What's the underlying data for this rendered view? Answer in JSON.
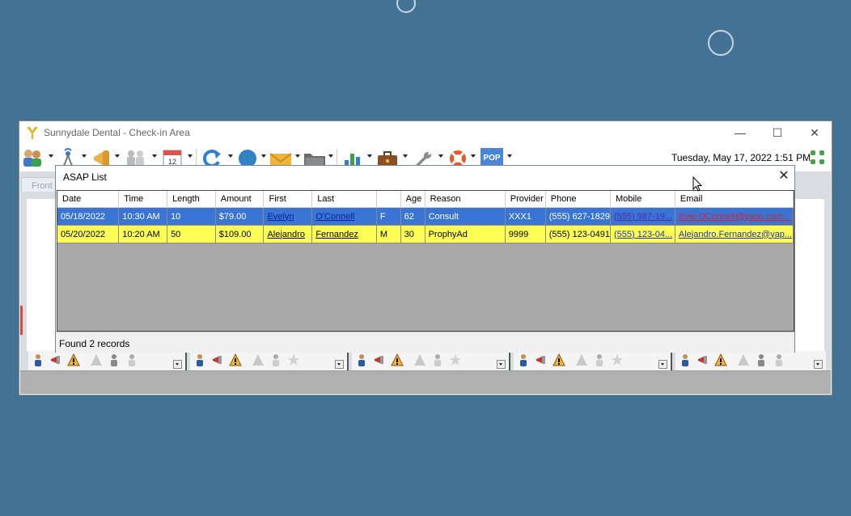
{
  "window": {
    "title": "Sunnydale Dental - Check-in Area",
    "clock": "Tuesday, May 17, 2022 1:51 PM",
    "tab_front": "Front",
    "controls": {
      "minimize": "—",
      "maximize": "☐",
      "close": "✕"
    }
  },
  "toolbar": {
    "items": [
      "patients-icon",
      "radio-icon",
      "megaphone-icon",
      "people-icon",
      "calendar-icon",
      "refresh-icon",
      "globe-icon",
      "envelope-icon",
      "folder-icon",
      "bar-chart-icon",
      "briefcase-icon",
      "wrench-icon",
      "lifebuoy-icon",
      "pop-icon"
    ],
    "calendar_day": "12",
    "pop_label": "POP"
  },
  "asap_dialog": {
    "title": "ASAP List",
    "close_label": "✕",
    "columns": [
      "Date",
      "Time",
      "Length",
      "Amount",
      "First",
      "Last",
      "",
      "Age",
      "Reason",
      "Provider",
      "Phone",
      "Mobile",
      "Email"
    ],
    "rows": [
      [
        "05/18/2022",
        "10:30 AM",
        "10",
        "$79.00",
        "Evelyn",
        "O'Connell",
        "F",
        "62",
        "Consult",
        "XXX1",
        "(555) 627-1829",
        "(555) 987-19...",
        "Evie.OConnell@yaoo.com..."
      ],
      [
        "05/20/2022",
        "10:20 AM",
        "50",
        "$109.00",
        "Alejandro",
        "Fernandez",
        "M",
        "30",
        "ProphyAd",
        "9999",
        "(555) 123-0491",
        "(555) 123-04...",
        "Alejandro.Fernandez@yap..."
      ]
    ],
    "status": "Found 2 records"
  },
  "colors": {
    "desktop": "#437394",
    "row_selected": "#3a74d4",
    "row_highlight": "#ffff55",
    "grid_empty": "#a9a9a9"
  }
}
